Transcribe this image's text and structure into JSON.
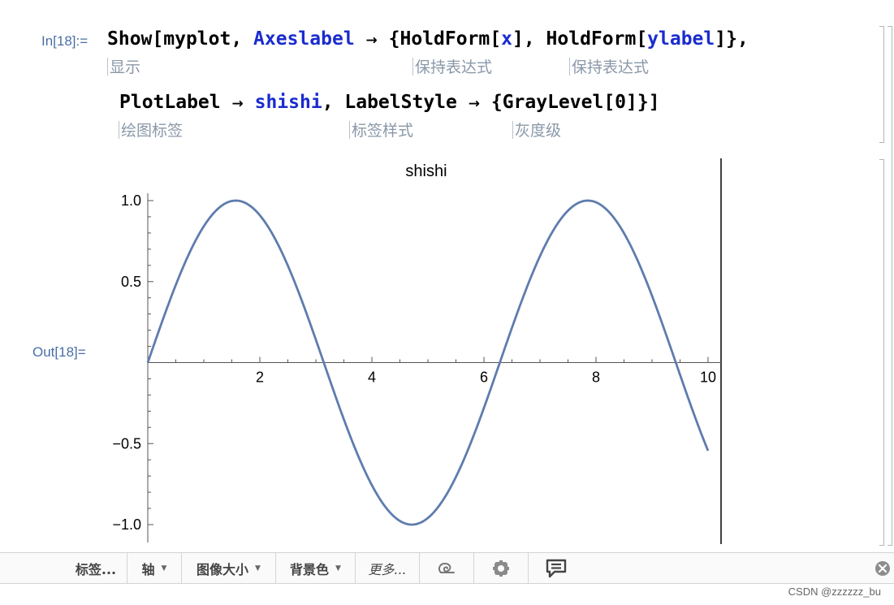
{
  "notebook": {
    "input_label": "In[18]:=",
    "output_label": "Out[18]=",
    "code_line1": {
      "fn": "Show",
      "arg1": "myplot",
      "opt": "Axeslabel",
      "arrow": "→",
      "holdform1": "HoldForm",
      "x": "x",
      "holdform2": "HoldForm",
      "ylabel": "ylabel"
    },
    "code_line2": {
      "opt1": "PlotLabel",
      "arrow": "→",
      "val1": "shishi",
      "opt2": "LabelStyle",
      "graylevel": "GrayLevel",
      "zero": "0"
    },
    "hints_line1": [
      "显示",
      "保持表达式",
      "保持表达式"
    ],
    "hints_line2": [
      "绘图标签",
      "标签样式",
      "灰度级"
    ]
  },
  "chart_data": {
    "type": "line",
    "title": "shishi",
    "function": "sin(x)",
    "xlim": [
      0,
      10
    ],
    "ylim": [
      -1.05,
      1.05
    ],
    "x_ticks": [
      "2",
      "4",
      "6",
      "8",
      "10"
    ],
    "y_ticks": [
      "1.0",
      "0.5",
      "−0.5",
      "−1.0"
    ],
    "series": [
      {
        "color": "#5e7cae",
        "x": [
          0,
          0.5,
          1,
          1.5708,
          2,
          2.5,
          3,
          3.1416,
          3.5,
          4,
          4.5,
          4.7124,
          5,
          5.5,
          6,
          6.2832,
          6.5,
          7,
          7.5,
          7.854,
          8,
          8.5,
          9,
          9.4248,
          10
        ],
        "y": [
          0,
          0.479,
          0.841,
          1.0,
          0.909,
          0.598,
          0.141,
          0,
          -0.351,
          -0.757,
          -0.978,
          -1.0,
          -0.959,
          -0.706,
          -0.279,
          0,
          0.215,
          0.657,
          0.938,
          1.0,
          0.989,
          0.798,
          0.412,
          0,
          -0.544
        ]
      }
    ]
  },
  "toolbar": {
    "items": [
      "标签...",
      "轴",
      "图像大小",
      "背景色",
      "更多..."
    ],
    "icons": [
      "swirl-icon",
      "gear-icon",
      "comment-icon",
      "close-circle-icon"
    ]
  },
  "footer": {
    "watermark": "CSDN @zzzzzz_bu"
  }
}
